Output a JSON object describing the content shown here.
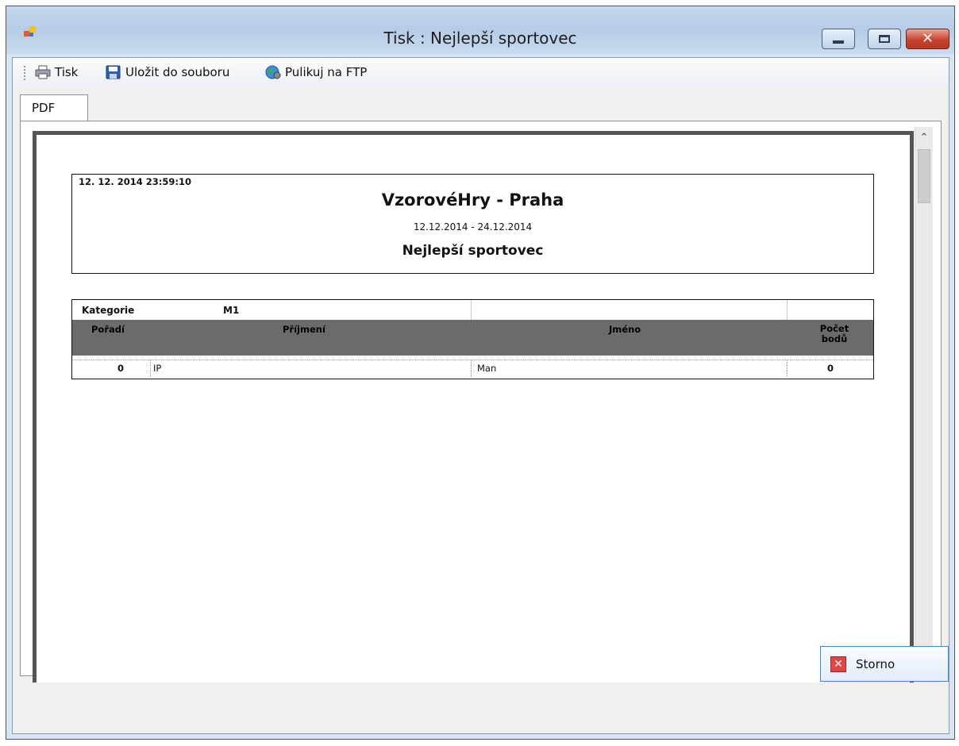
{
  "window": {
    "title": "Tisk : Nejlepší sportovec",
    "close_glyph": "✕"
  },
  "toolbar": {
    "print_label": "Tisk",
    "save_label": "Uložit do souboru",
    "ftp_label": "Pulikuj na FTP"
  },
  "tabs": [
    {
      "label": "PDF"
    }
  ],
  "scrollbar": {
    "up_glyph": "⌃",
    "down_glyph": "⌄"
  },
  "report": {
    "datetime": "12. 12. 2014 23:59:10",
    "event": "VzorovéHry - Praha",
    "dates": "12.12.2014 - 24.12.2014",
    "report_title": "Nejlepší sportovec",
    "category_label": "Kategorie",
    "category_value": "M1",
    "columns": {
      "order": "Pořadí",
      "surname": "Příjmení",
      "name": "Jméno",
      "points_line1": "Počet",
      "points_line2": "bodů"
    },
    "rows": [
      {
        "order": "0",
        "surname": "IP",
        "name": "Man",
        "points": "0"
      }
    ]
  },
  "footer": {
    "cancel_label": "Storno",
    "cancel_glyph": "✕"
  }
}
